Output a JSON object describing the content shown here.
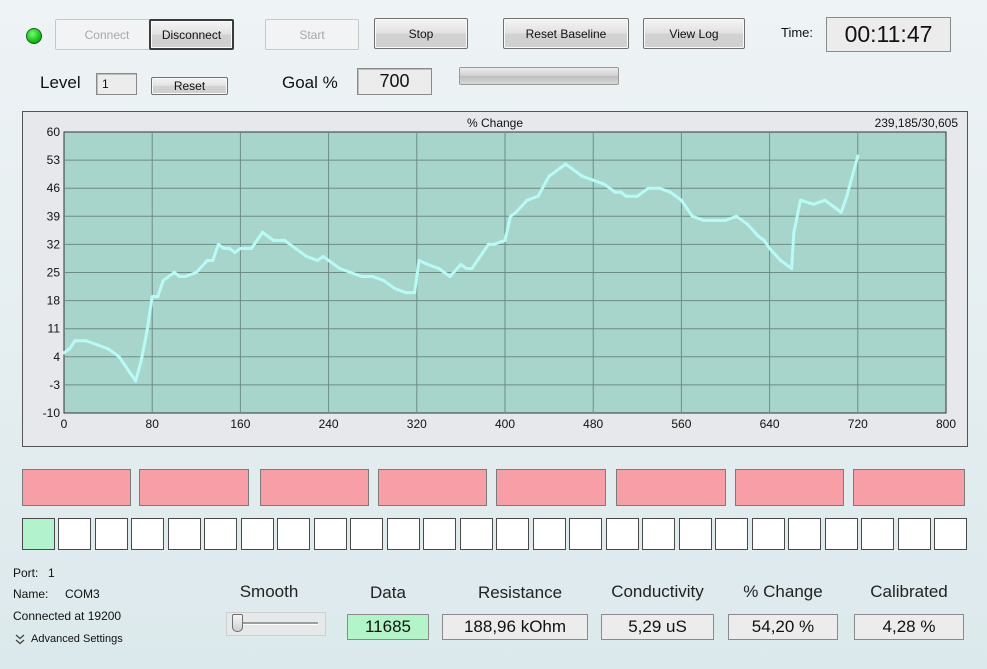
{
  "toolbar": {
    "connect": "Connect",
    "disconnect": "Disconnect",
    "start": "Start",
    "stop": "Stop",
    "reset_baseline": "Reset Baseline",
    "view_log": "View Log",
    "time_label": "Time:",
    "time_value": "00:11:47"
  },
  "level": {
    "label": "Level",
    "value": "1",
    "reset": "Reset"
  },
  "goal": {
    "label": "Goal %",
    "value": "700",
    "progress": 0
  },
  "chart_data": {
    "type": "line",
    "title": "% Change",
    "corner_text": "239,185/30,605",
    "xlabel": "",
    "ylabel": "",
    "xlim": [
      0,
      800
    ],
    "ylim": [
      -10,
      60
    ],
    "x_ticks": [
      0,
      80,
      160,
      240,
      320,
      400,
      480,
      560,
      640,
      720,
      800
    ],
    "y_ticks": [
      -10,
      -3,
      4,
      11,
      18,
      25,
      32,
      39,
      46,
      53,
      60
    ],
    "grid": true,
    "line_color": "#b8fbf6",
    "series": [
      {
        "x": [
          0,
          5,
          10,
          20,
          30,
          40,
          50,
          55,
          60,
          65,
          70,
          75,
          80,
          85,
          90,
          100,
          105,
          110,
          120,
          130,
          135,
          140,
          145,
          150,
          155,
          160,
          170,
          180,
          185,
          190,
          200,
          210,
          220,
          230,
          235,
          240,
          250,
          260,
          270,
          280,
          290,
          300,
          310,
          318,
          322,
          330,
          340,
          350,
          360,
          365,
          370,
          380,
          385,
          390,
          400,
          405,
          410,
          420,
          430,
          440,
          450,
          455,
          460,
          470,
          480,
          490,
          500,
          505,
          510,
          520,
          530,
          540,
          550,
          560,
          570,
          580,
          590,
          600,
          610,
          620,
          630,
          635,
          640,
          650,
          660,
          662,
          668,
          680,
          690,
          700,
          705,
          710,
          720
        ],
        "y": [
          5,
          6,
          8,
          8,
          7,
          6,
          4,
          2,
          0,
          -2,
          3,
          10,
          19,
          19,
          23,
          25,
          24,
          24,
          25,
          28,
          28,
          32,
          31,
          31,
          30,
          31,
          31,
          35,
          34,
          33,
          33,
          31,
          29,
          28,
          29,
          28,
          26,
          25,
          24,
          24,
          23,
          21,
          20,
          20,
          28,
          27,
          26,
          24,
          27,
          26,
          26,
          30,
          32,
          32,
          33,
          39,
          40,
          43,
          44,
          49,
          51,
          52,
          51,
          49,
          48,
          47,
          45,
          45,
          44,
          44,
          46,
          46,
          45,
          43,
          39,
          38,
          38,
          38,
          39,
          37,
          34,
          33,
          31,
          28,
          26,
          35,
          43,
          42,
          43,
          41,
          40,
          44,
          54
        ]
      }
    ]
  },
  "electrodes": {
    "pink_count": 8,
    "squares": [
      true,
      false,
      false,
      false,
      false,
      false,
      false,
      false,
      false,
      false,
      false,
      false,
      false,
      false,
      false,
      false,
      false,
      false,
      false,
      false,
      false,
      false,
      false,
      false,
      false,
      false
    ]
  },
  "status": {
    "port_label": "Port:",
    "port_value": "1",
    "name_label": "Name:",
    "name_value": "COM3",
    "connected_text": "Connected at 19200",
    "advanced_settings": "Advanced Settings"
  },
  "meters": {
    "smooth_label": "Smooth",
    "smooth_level": 0,
    "data_label": "Data",
    "data_value": "11685",
    "resistance_label": "Resistance",
    "resistance_value": "188,96 kOhm",
    "conductivity_label": "Conductivity",
    "conductivity_value": "5,29 uS",
    "change_label": "% Change",
    "change_value": "54,20 %",
    "calibrated_label": "Calibrated",
    "calibrated_value": "4,28 %"
  }
}
